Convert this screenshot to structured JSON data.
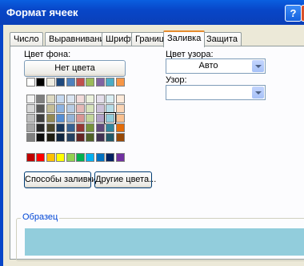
{
  "window": {
    "title": "Формат ячеек",
    "help_label": "?",
    "close_label": "X"
  },
  "tabs": [
    "Число",
    "Выравнивание",
    "Шрифт",
    "Граница",
    "Заливка",
    "Защита"
  ],
  "active_tab": "Заливка",
  "left": {
    "bg_color_label": "Цвет фона:",
    "no_color_button": "Нет цвета",
    "fill_effects_button": "Способы заливки...",
    "more_colors_button": "Другие цвета..."
  },
  "right": {
    "pattern_color_label": "Цвет узора:",
    "pattern_color_value": "Авто",
    "pattern_style_label": "Узор:",
    "pattern_style_value": ""
  },
  "sample": {
    "label": "Образец",
    "color": "#92cddc"
  },
  "palette": {
    "theme_row": [
      "#ffffff",
      "#000000",
      "#eeece1",
      "#1f497d",
      "#4f81bd",
      "#c0504d",
      "#9bbb59",
      "#8064a2",
      "#4bacc6",
      "#f79646"
    ],
    "tint_rows": [
      [
        "#f2f2f2",
        "#7f7f7f",
        "#ddd9c3",
        "#c6d9f0",
        "#dbe5f1",
        "#f2dcdb",
        "#ebf1dd",
        "#e5e0ec",
        "#dbeef3",
        "#fdeada"
      ],
      [
        "#d8d8d8",
        "#595959",
        "#c4bd97",
        "#8db3e2",
        "#b8cce4",
        "#e5b9b7",
        "#d7e3bc",
        "#ccc1d9",
        "#b7dde8",
        "#fbd5b5"
      ],
      [
        "#bfbfbf",
        "#3f3f3f",
        "#938953",
        "#548dd4",
        "#95b3d7",
        "#d99694",
        "#c3d69b",
        "#b2a2c7",
        "#92cddc",
        "#fac08f"
      ],
      [
        "#a5a5a5",
        "#262626",
        "#494429",
        "#17365d",
        "#366092",
        "#953734",
        "#76923c",
        "#5f497a",
        "#31859b",
        "#e36c09"
      ],
      [
        "#7f7f7f",
        "#0c0c0c",
        "#1d1b10",
        "#0f243e",
        "#244061",
        "#632423",
        "#4f6128",
        "#3f3151",
        "#205867",
        "#974806"
      ]
    ],
    "standard_row": [
      "#c00000",
      "#ff0000",
      "#ffc000",
      "#ffff00",
      "#92d050",
      "#00b050",
      "#00b0f0",
      "#0070c0",
      "#002060",
      "#7030a0"
    ],
    "selected": "#92cddc"
  }
}
